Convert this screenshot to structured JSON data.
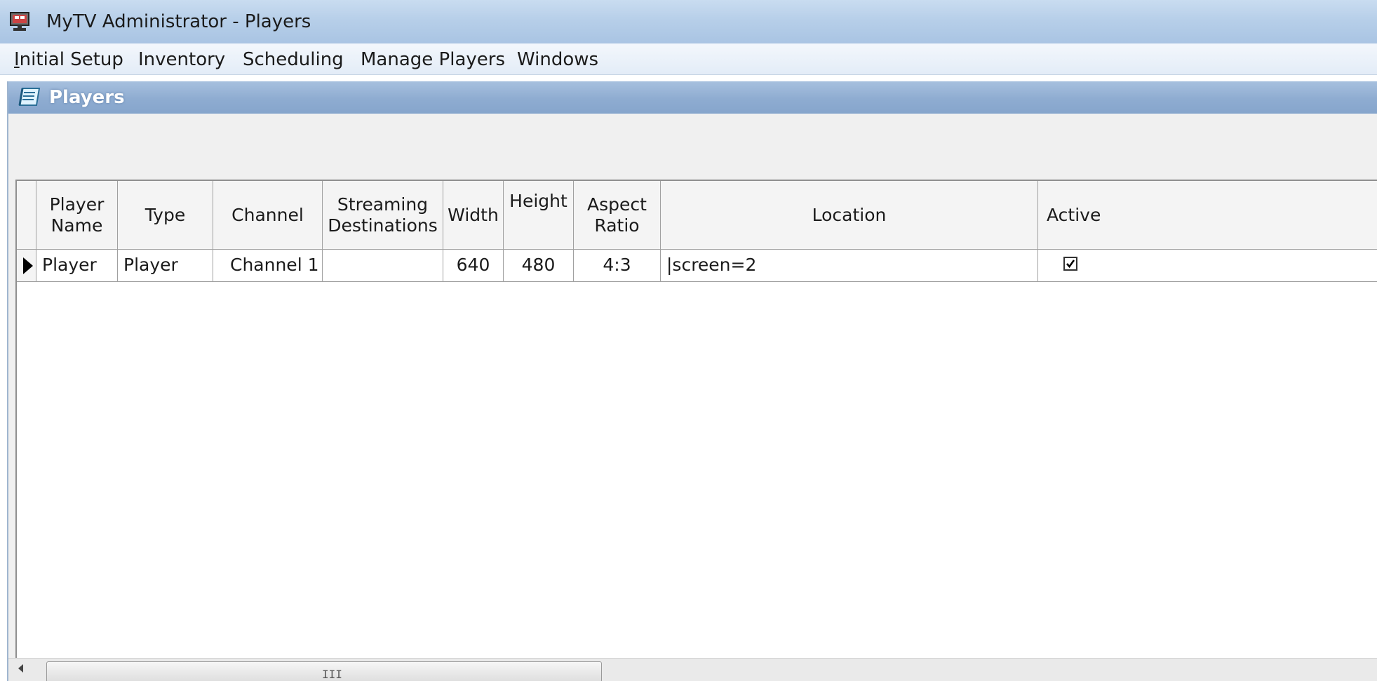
{
  "window": {
    "title": "MyTV Administrator - Players",
    "icon": "app-monitor-icon"
  },
  "menu": {
    "items": [
      {
        "accel": "I",
        "rest": "nitial Setup"
      },
      {
        "accel": "",
        "rest": "Inventory"
      },
      {
        "accel": "",
        "rest": "Scheduling"
      },
      {
        "accel": "",
        "rest": "Manage Players"
      },
      {
        "accel": "",
        "rest": "Windows"
      }
    ]
  },
  "child": {
    "title": "Players",
    "icon": "players-form-icon"
  },
  "grid": {
    "headers": [
      {
        "lines": [
          "Player",
          "Name"
        ]
      },
      {
        "lines": [
          "Type"
        ]
      },
      {
        "lines": [
          "Channel"
        ]
      },
      {
        "lines": [
          "Streaming",
          "Destinations"
        ]
      },
      {
        "lines": [
          "Width"
        ]
      },
      {
        "lines": [
          "Height"
        ]
      },
      {
        "lines": [
          "Aspect",
          "Ratio"
        ]
      },
      {
        "lines": [
          "Location"
        ]
      },
      {
        "lines": [
          "Active"
        ]
      }
    ],
    "rows": [
      {
        "player_name": "Player",
        "type": "Player",
        "channel": "Channel 1",
        "streaming_destinations": "",
        "width": "640",
        "height": "480",
        "aspect_ratio": "4:3",
        "location": "|screen=2",
        "active": true
      }
    ]
  },
  "scrollbar": {
    "grip": "III"
  }
}
